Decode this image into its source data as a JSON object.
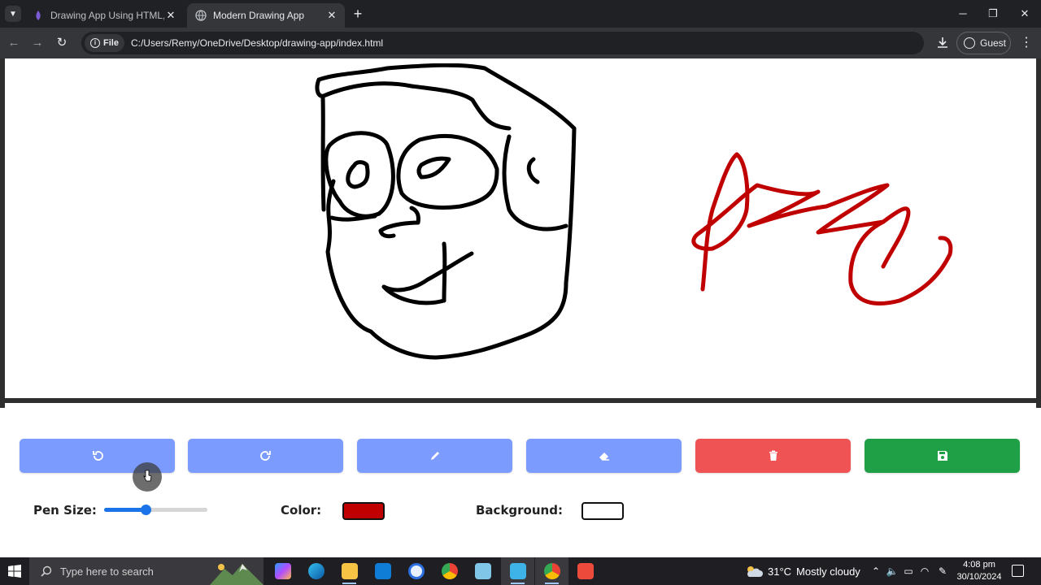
{
  "browser": {
    "tabs": [
      {
        "title": "Drawing App Using HTML, CSS",
        "active": false
      },
      {
        "title": "Modern Drawing App",
        "active": true
      }
    ],
    "address": {
      "scheme_chip": "File",
      "url": "C:/Users/Remy/OneDrive/Desktop/drawing-app/index.html"
    },
    "profile_label": "Guest"
  },
  "app": {
    "buttons": [
      {
        "name": "undo",
        "icon": "undo-icon",
        "color": "#7b9bff"
      },
      {
        "name": "redo",
        "icon": "redo-icon",
        "color": "#7b9bff"
      },
      {
        "name": "pen",
        "icon": "pencil-icon",
        "color": "#7b9bff"
      },
      {
        "name": "eraser",
        "icon": "eraser-icon",
        "color": "#7b9bff"
      },
      {
        "name": "clear",
        "icon": "trash-icon",
        "color": "#f05353"
      },
      {
        "name": "save",
        "icon": "save-icon",
        "color": "#1fa047"
      }
    ],
    "controls": {
      "pen_size_label": "Pen Size:",
      "pen_size_fraction": 0.4,
      "color_label": "Color:",
      "color_value": "#c00000",
      "background_label": "Background:",
      "background_value": "#ffffff"
    }
  },
  "taskbar": {
    "search_placeholder": "Type here to search",
    "weather": {
      "temp": "31°C",
      "condition": "Mostly cloudy"
    },
    "clock": {
      "time": "4:08 pm",
      "date": "30/10/2024"
    }
  }
}
